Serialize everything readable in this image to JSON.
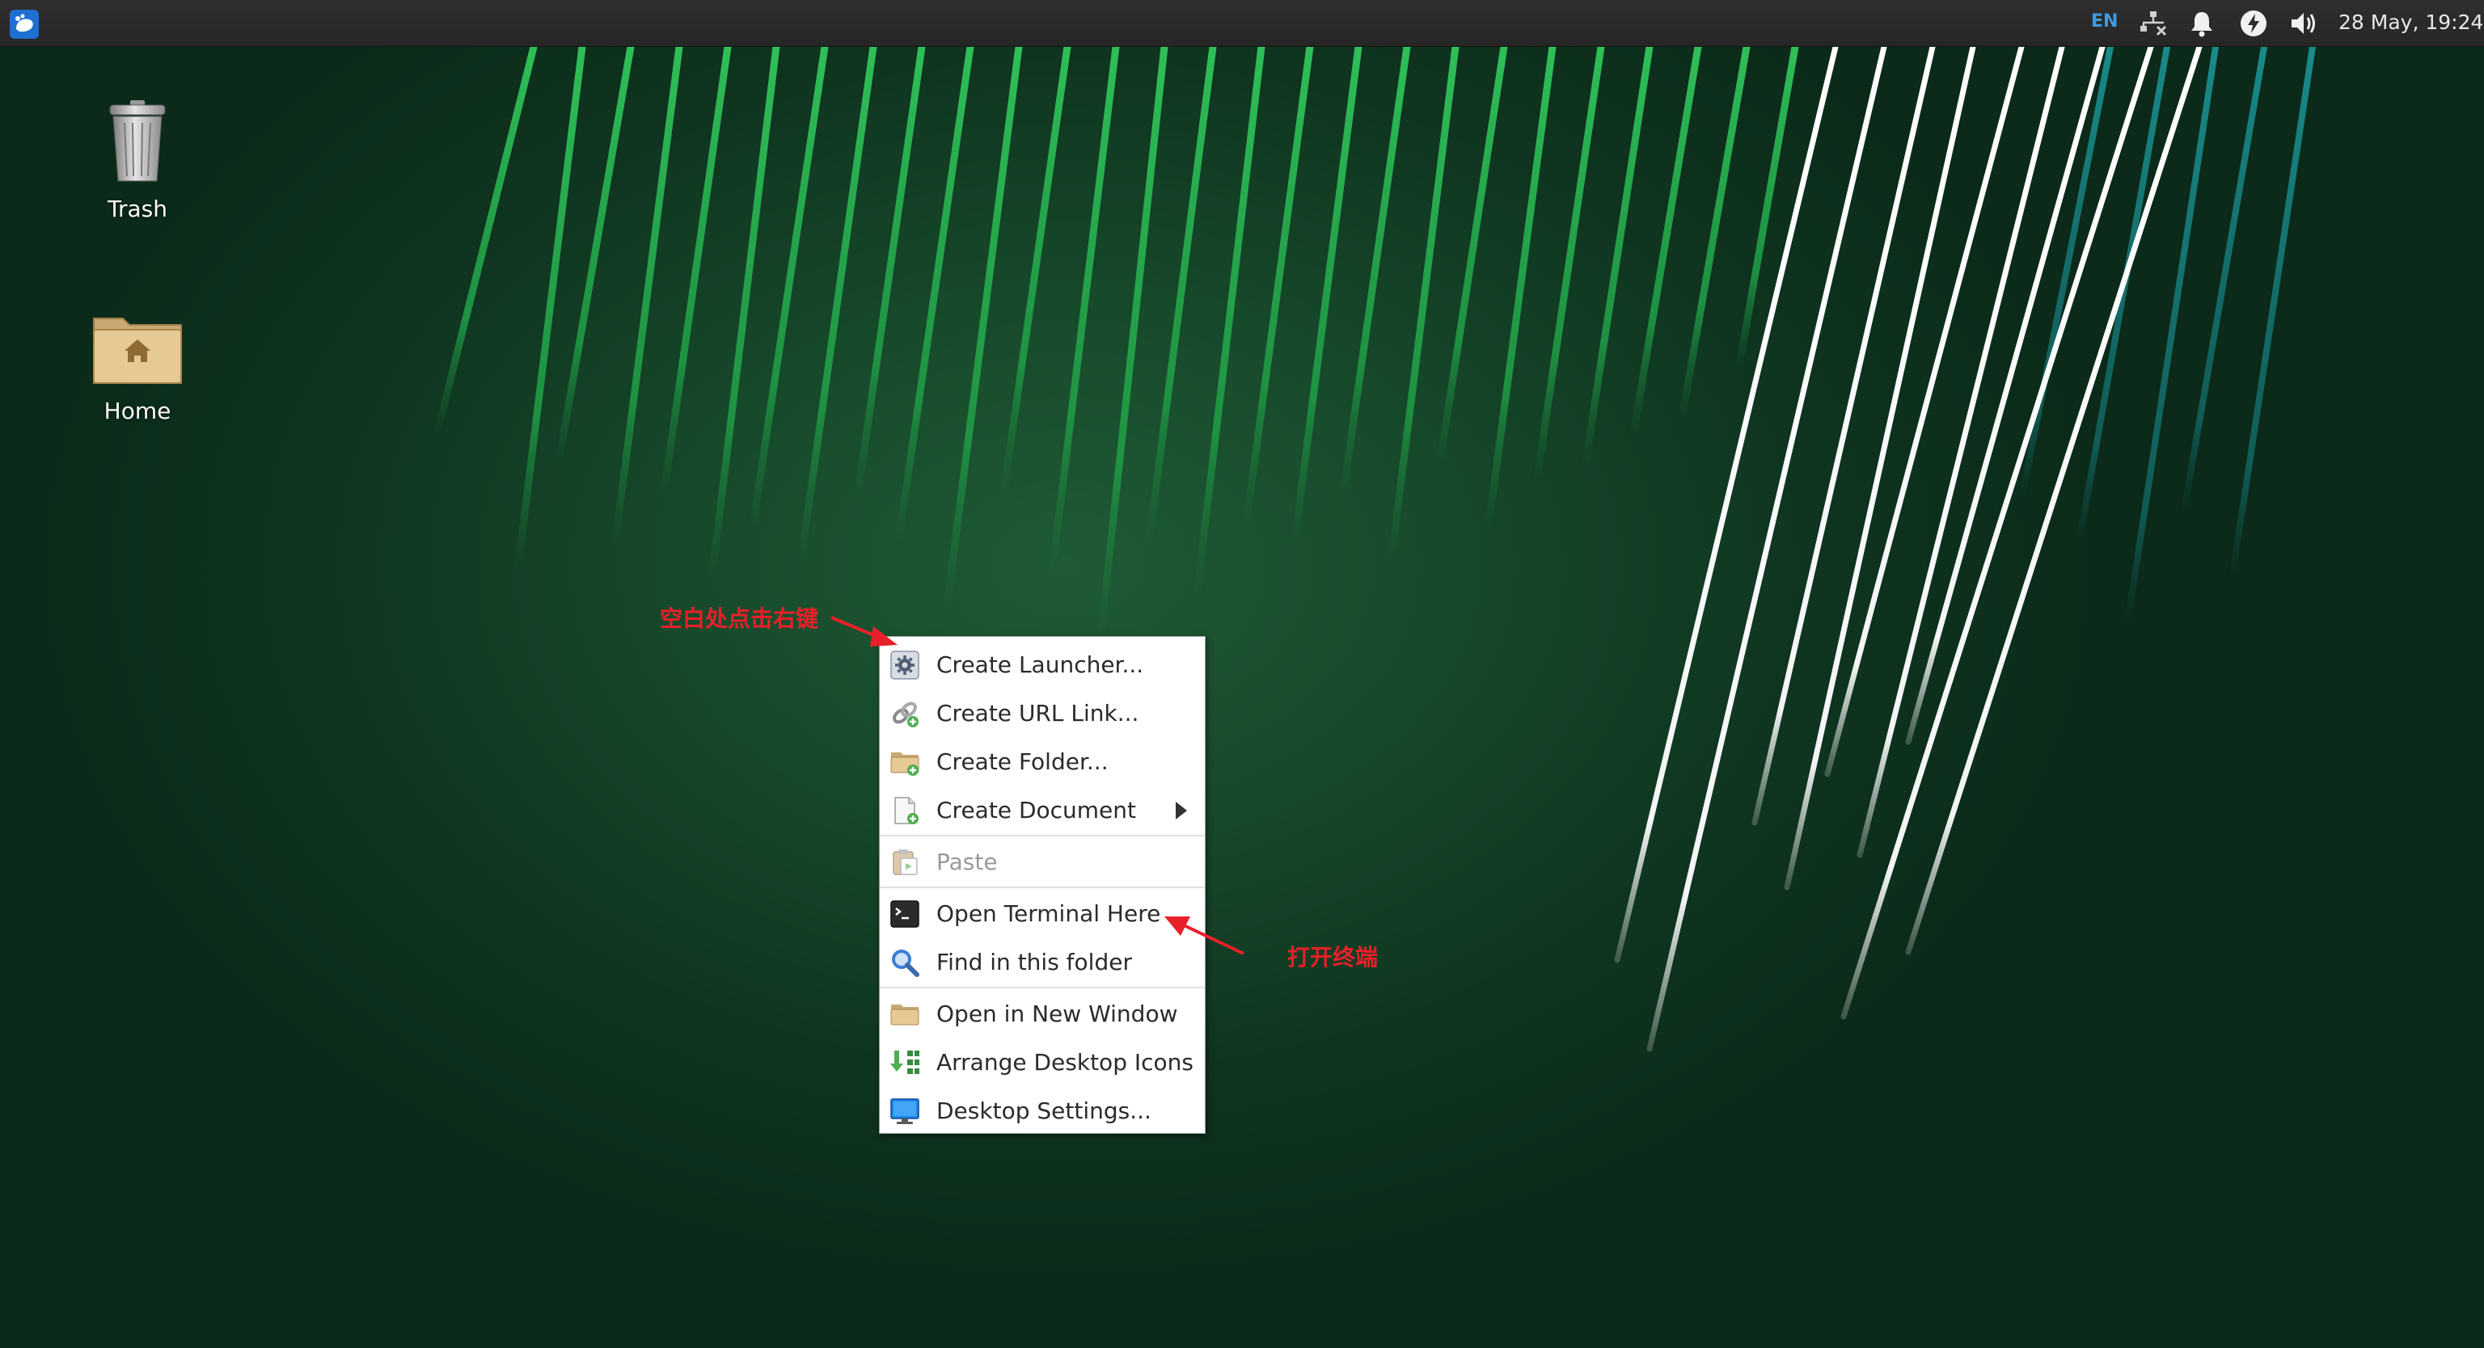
{
  "panel": {
    "language_indicator": "EN",
    "clock": "28 May, 19:24",
    "icons": [
      "xfce-mouse-icon",
      "network-disconnected-icon",
      "notification-bell-icon",
      "power-icon",
      "volume-icon"
    ]
  },
  "desktop": {
    "icons": [
      {
        "label": "Trash",
        "icon": "trash-icon"
      },
      {
        "label": "Home",
        "icon": "home-folder-icon"
      }
    ]
  },
  "context_menu": {
    "items": [
      {
        "label": "Create Launcher...",
        "icon": "gear-icon",
        "disabled": false
      },
      {
        "label": "Create URL Link...",
        "icon": "link-icon",
        "disabled": false
      },
      {
        "label": "Create Folder...",
        "icon": "new-folder-icon",
        "disabled": false
      },
      {
        "label": "Create Document",
        "icon": "new-document-icon",
        "disabled": false,
        "submenu": true
      },
      {
        "label": "Paste",
        "icon": "paste-icon",
        "disabled": true
      },
      {
        "label": "Open Terminal Here",
        "icon": "terminal-icon",
        "disabled": false
      },
      {
        "label": "Find in this folder",
        "icon": "search-icon",
        "disabled": false
      },
      {
        "label": "Open in New Window",
        "icon": "folder-icon",
        "disabled": false
      },
      {
        "label": "Arrange Desktop Icons",
        "icon": "arrange-icon",
        "disabled": false
      },
      {
        "label": "Desktop Settings...",
        "icon": "display-icon",
        "disabled": false
      }
    ]
  },
  "annotations": {
    "right_click_hint": "空白处点击右键",
    "open_terminal_hint": "打开终端"
  },
  "colors": {
    "annotation": "#e8202a",
    "panel": "#2a2a2a",
    "desktop": "#174a2b",
    "language_indicator": "#3d9be0"
  }
}
